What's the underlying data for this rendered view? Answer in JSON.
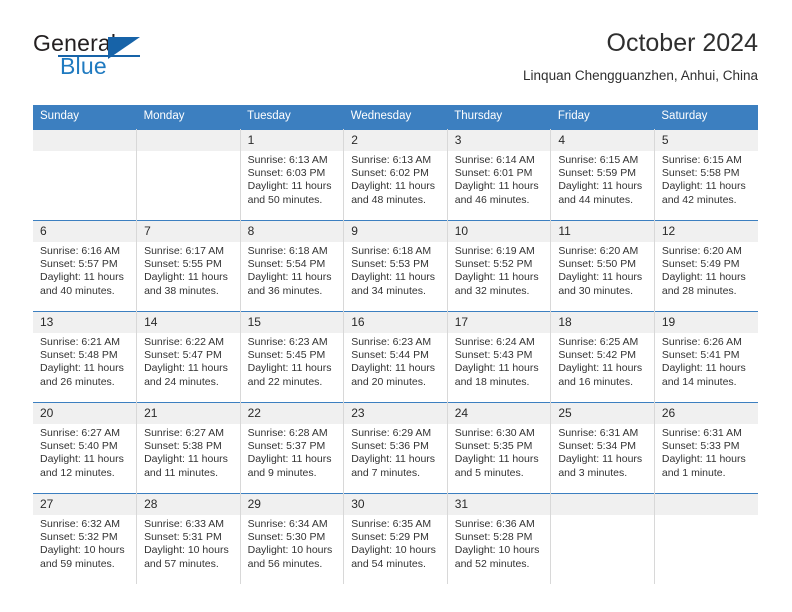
{
  "brand": {
    "name_part1": "General",
    "name_part2": "Blue",
    "logo_icon": "triangle-logo-icon"
  },
  "header": {
    "title": "October 2024",
    "subtitle": "Linquan Chengguanzhen, Anhui, China"
  },
  "colors": {
    "header_blue": "#3c7fc0",
    "brand_blue": "#1f7ac0",
    "daynum_band": "#f0f0f0",
    "cell_border": "#d8d8d8"
  },
  "calendar": {
    "weekday_headers": [
      "Sunday",
      "Monday",
      "Tuesday",
      "Wednesday",
      "Thursday",
      "Friday",
      "Saturday"
    ],
    "weeks": [
      [
        {
          "day": "",
          "empty": true
        },
        {
          "day": "",
          "empty": true
        },
        {
          "day": "1",
          "sunrise": "Sunrise: 6:13 AM",
          "sunset": "Sunset: 6:03 PM",
          "daylight": "Daylight: 11 hours and 50 minutes."
        },
        {
          "day": "2",
          "sunrise": "Sunrise: 6:13 AM",
          "sunset": "Sunset: 6:02 PM",
          "daylight": "Daylight: 11 hours and 48 minutes."
        },
        {
          "day": "3",
          "sunrise": "Sunrise: 6:14 AM",
          "sunset": "Sunset: 6:01 PM",
          "daylight": "Daylight: 11 hours and 46 minutes."
        },
        {
          "day": "4",
          "sunrise": "Sunrise: 6:15 AM",
          "sunset": "Sunset: 5:59 PM",
          "daylight": "Daylight: 11 hours and 44 minutes."
        },
        {
          "day": "5",
          "sunrise": "Sunrise: 6:15 AM",
          "sunset": "Sunset: 5:58 PM",
          "daylight": "Daylight: 11 hours and 42 minutes."
        }
      ],
      [
        {
          "day": "6",
          "sunrise": "Sunrise: 6:16 AM",
          "sunset": "Sunset: 5:57 PM",
          "daylight": "Daylight: 11 hours and 40 minutes."
        },
        {
          "day": "7",
          "sunrise": "Sunrise: 6:17 AM",
          "sunset": "Sunset: 5:55 PM",
          "daylight": "Daylight: 11 hours and 38 minutes."
        },
        {
          "day": "8",
          "sunrise": "Sunrise: 6:18 AM",
          "sunset": "Sunset: 5:54 PM",
          "daylight": "Daylight: 11 hours and 36 minutes."
        },
        {
          "day": "9",
          "sunrise": "Sunrise: 6:18 AM",
          "sunset": "Sunset: 5:53 PM",
          "daylight": "Daylight: 11 hours and 34 minutes."
        },
        {
          "day": "10",
          "sunrise": "Sunrise: 6:19 AM",
          "sunset": "Sunset: 5:52 PM",
          "daylight": "Daylight: 11 hours and 32 minutes."
        },
        {
          "day": "11",
          "sunrise": "Sunrise: 6:20 AM",
          "sunset": "Sunset: 5:50 PM",
          "daylight": "Daylight: 11 hours and 30 minutes."
        },
        {
          "day": "12",
          "sunrise": "Sunrise: 6:20 AM",
          "sunset": "Sunset: 5:49 PM",
          "daylight": "Daylight: 11 hours and 28 minutes."
        }
      ],
      [
        {
          "day": "13",
          "sunrise": "Sunrise: 6:21 AM",
          "sunset": "Sunset: 5:48 PM",
          "daylight": "Daylight: 11 hours and 26 minutes."
        },
        {
          "day": "14",
          "sunrise": "Sunrise: 6:22 AM",
          "sunset": "Sunset: 5:47 PM",
          "daylight": "Daylight: 11 hours and 24 minutes."
        },
        {
          "day": "15",
          "sunrise": "Sunrise: 6:23 AM",
          "sunset": "Sunset: 5:45 PM",
          "daylight": "Daylight: 11 hours and 22 minutes."
        },
        {
          "day": "16",
          "sunrise": "Sunrise: 6:23 AM",
          "sunset": "Sunset: 5:44 PM",
          "daylight": "Daylight: 11 hours and 20 minutes."
        },
        {
          "day": "17",
          "sunrise": "Sunrise: 6:24 AM",
          "sunset": "Sunset: 5:43 PM",
          "daylight": "Daylight: 11 hours and 18 minutes."
        },
        {
          "day": "18",
          "sunrise": "Sunrise: 6:25 AM",
          "sunset": "Sunset: 5:42 PM",
          "daylight": "Daylight: 11 hours and 16 minutes."
        },
        {
          "day": "19",
          "sunrise": "Sunrise: 6:26 AM",
          "sunset": "Sunset: 5:41 PM",
          "daylight": "Daylight: 11 hours and 14 minutes."
        }
      ],
      [
        {
          "day": "20",
          "sunrise": "Sunrise: 6:27 AM",
          "sunset": "Sunset: 5:40 PM",
          "daylight": "Daylight: 11 hours and 12 minutes."
        },
        {
          "day": "21",
          "sunrise": "Sunrise: 6:27 AM",
          "sunset": "Sunset: 5:38 PM",
          "daylight": "Daylight: 11 hours and 11 minutes."
        },
        {
          "day": "22",
          "sunrise": "Sunrise: 6:28 AM",
          "sunset": "Sunset: 5:37 PM",
          "daylight": "Daylight: 11 hours and 9 minutes."
        },
        {
          "day": "23",
          "sunrise": "Sunrise: 6:29 AM",
          "sunset": "Sunset: 5:36 PM",
          "daylight": "Daylight: 11 hours and 7 minutes."
        },
        {
          "day": "24",
          "sunrise": "Sunrise: 6:30 AM",
          "sunset": "Sunset: 5:35 PM",
          "daylight": "Daylight: 11 hours and 5 minutes."
        },
        {
          "day": "25",
          "sunrise": "Sunrise: 6:31 AM",
          "sunset": "Sunset: 5:34 PM",
          "daylight": "Daylight: 11 hours and 3 minutes."
        },
        {
          "day": "26",
          "sunrise": "Sunrise: 6:31 AM",
          "sunset": "Sunset: 5:33 PM",
          "daylight": "Daylight: 11 hours and 1 minute."
        }
      ],
      [
        {
          "day": "27",
          "sunrise": "Sunrise: 6:32 AM",
          "sunset": "Sunset: 5:32 PM",
          "daylight": "Daylight: 10 hours and 59 minutes."
        },
        {
          "day": "28",
          "sunrise": "Sunrise: 6:33 AM",
          "sunset": "Sunset: 5:31 PM",
          "daylight": "Daylight: 10 hours and 57 minutes."
        },
        {
          "day": "29",
          "sunrise": "Sunrise: 6:34 AM",
          "sunset": "Sunset: 5:30 PM",
          "daylight": "Daylight: 10 hours and 56 minutes."
        },
        {
          "day": "30",
          "sunrise": "Sunrise: 6:35 AM",
          "sunset": "Sunset: 5:29 PM",
          "daylight": "Daylight: 10 hours and 54 minutes."
        },
        {
          "day": "31",
          "sunrise": "Sunrise: 6:36 AM",
          "sunset": "Sunset: 5:28 PM",
          "daylight": "Daylight: 10 hours and 52 minutes."
        },
        {
          "day": "",
          "empty": true
        },
        {
          "day": "",
          "empty": true
        }
      ]
    ]
  }
}
